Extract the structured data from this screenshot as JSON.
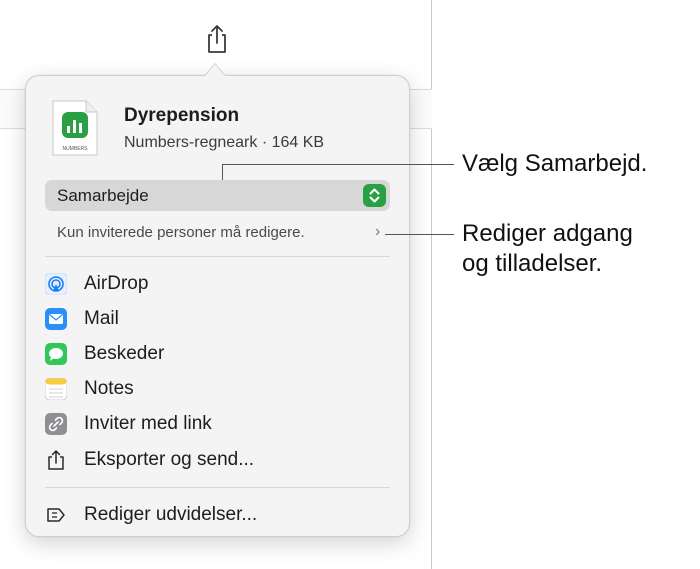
{
  "file": {
    "icon_caption": "NUMBERS",
    "title": "Dyrepension",
    "subtitle": "Numbers-regneark · 164 KB"
  },
  "collaboration": {
    "selected": "Samarbejde",
    "access_text": "Kun inviterede personer må redigere.",
    "chevron": "›"
  },
  "menu": {
    "items": [
      {
        "label": "AirDrop",
        "icon": "airdrop-icon"
      },
      {
        "label": "Mail",
        "icon": "mail-icon"
      },
      {
        "label": "Beskeder",
        "icon": "messages-icon"
      },
      {
        "label": "Notes",
        "icon": "notes-icon"
      },
      {
        "label": "Inviter med link",
        "icon": "link-icon"
      },
      {
        "label": "Eksporter og send...",
        "icon": "export-icon"
      }
    ],
    "footer": {
      "label": "Rediger udvidelser...",
      "icon": "extensions-icon"
    }
  },
  "callouts": {
    "first": "Vælg Samarbejd.",
    "second_line1": "Rediger adgang",
    "second_line2": "og tilladelser."
  },
  "colors": {
    "numbers_green": "#2aa045",
    "airdrop_blue": "#1c7cf4",
    "mail_blue": "#2b8ff7",
    "messages_green": "#33c75a",
    "notes_yellow": "#f6cd3c",
    "link_gray": "#8e8e93"
  }
}
